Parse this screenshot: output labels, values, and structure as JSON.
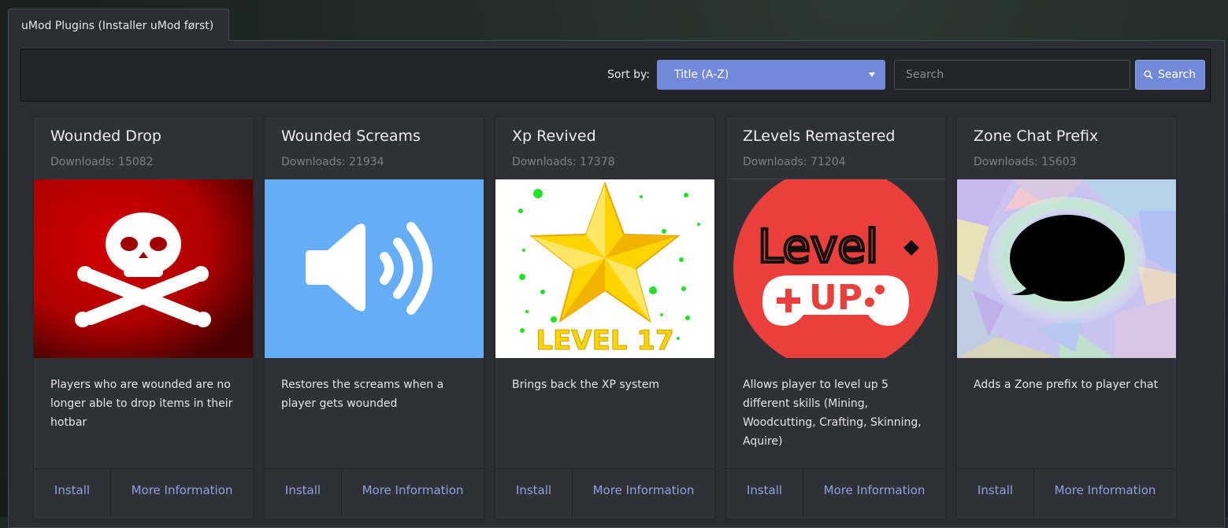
{
  "tab": {
    "label": "uMod Plugins (Installer uMod først)"
  },
  "toolbar": {
    "sort_label": "Sort by:",
    "sort_value": "Title (A-Z)",
    "search_placeholder": "Search",
    "search_button": "Search"
  },
  "colors": {
    "accent": "#7289da",
    "link": "#8ea1e1",
    "panel": "#2b2d33",
    "card": "#2f3136"
  },
  "cards": [
    {
      "title": "Wounded Drop",
      "downloads": "Downloads: 15082",
      "description": "Players who are wounded are no longer able to drop items in their hotbar",
      "icon": "skull-crossbones-icon",
      "install": "Install",
      "more": "More Information"
    },
    {
      "title": "Wounded Screams",
      "downloads": "Downloads: 21934",
      "description": "Restores the screams when a player gets wounded",
      "icon": "speaker-volume-icon",
      "install": "Install",
      "more": "More Information"
    },
    {
      "title": "Xp Revived",
      "downloads": "Downloads: 17378",
      "description": "Brings back the XP system",
      "icon": "gold-star-icon",
      "image_text": "LEVEL 17",
      "install": "Install",
      "more": "More Information"
    },
    {
      "title": "ZLevels Remastered",
      "downloads": "Downloads: 71204",
      "description": "Allows player to level up 5 different skills (Mining, Woodcutting, Crafting, Skinning, Aquire)",
      "icon": "level-up-gamepad-icon",
      "image_text_1": "Level",
      "image_text_2": "UP",
      "install": "Install",
      "more": "More Information"
    },
    {
      "title": "Zone Chat Prefix",
      "downloads": "Downloads: 15603",
      "description": "Adds a Zone prefix to player chat",
      "icon": "speech-bubble-icon",
      "install": "Install",
      "more": "More Information"
    }
  ]
}
